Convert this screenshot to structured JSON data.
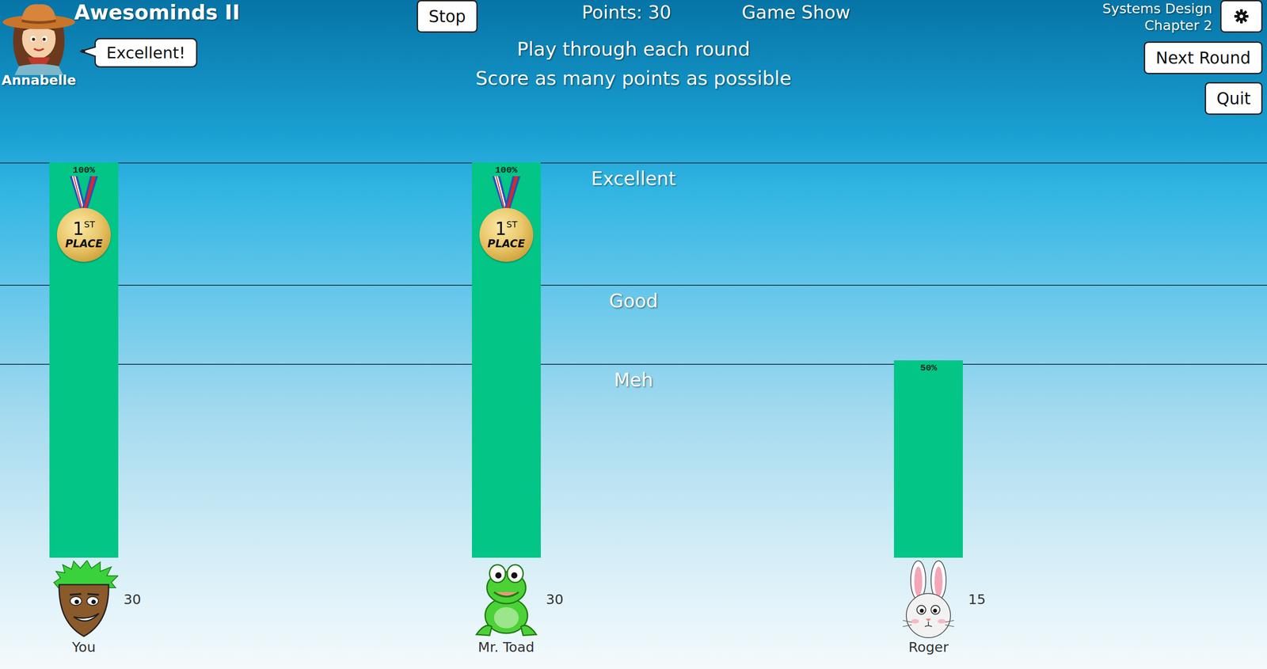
{
  "header": {
    "title": "Awesominds II",
    "host": {
      "name": "Annabelle",
      "speech": "Excellent!"
    },
    "points": "Points: 30",
    "mode": "Game Show",
    "instructions": [
      "Play through each round",
      "Score as many points as possible"
    ],
    "course": [
      "Systems Design",
      "Chapter 2"
    ]
  },
  "buttons": {
    "stop": "Stop",
    "next": "Next Round",
    "quit": "Quit"
  },
  "thresholds": [
    {
      "label": "Excellent",
      "value": 100
    },
    {
      "label": "Good",
      "value": 69
    },
    {
      "label": "Meh",
      "value": 49
    }
  ],
  "players": [
    {
      "name": "You",
      "score": "30",
      "level": 1.0,
      "percent": "100%",
      "medal": {
        "rank": "1",
        "suffix": "ST",
        "label": "PLACE"
      }
    },
    {
      "name": "Mr. Toad",
      "score": "30",
      "level": 1.0,
      "percent": "100%",
      "medal": {
        "rank": "1",
        "suffix": "ST",
        "label": "PLACE"
      }
    },
    {
      "name": "Roger",
      "score": "15",
      "level": 0.5,
      "percent": "50%"
    }
  ]
}
